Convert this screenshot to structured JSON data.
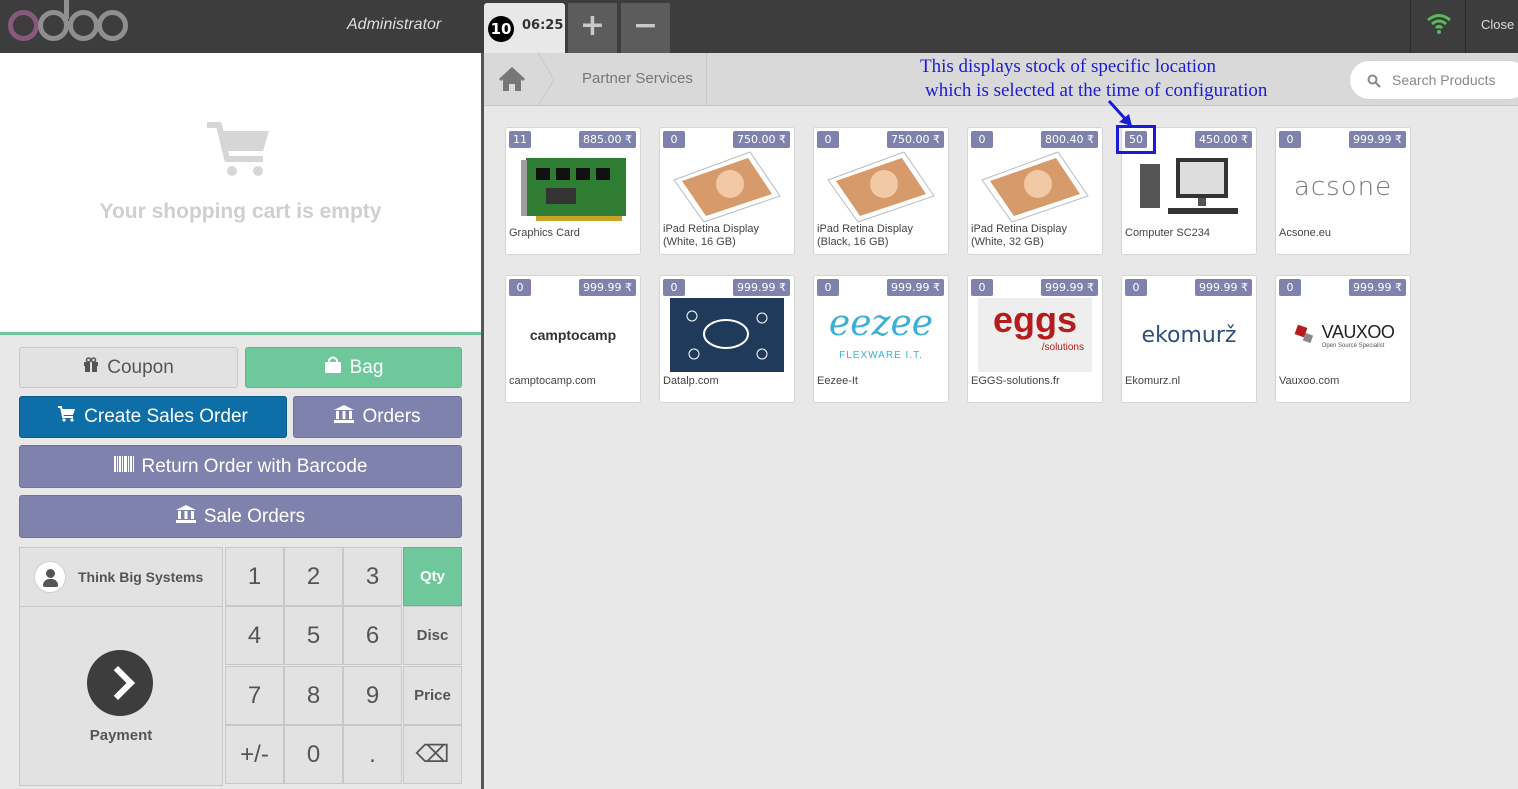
{
  "header": {
    "user": "Administrator",
    "order_number": "10",
    "order_time": "06:25",
    "add_label": "+",
    "remove_label": "−",
    "close_label": "Close"
  },
  "cart": {
    "empty_text": "Your shopping cart is empty"
  },
  "actions": {
    "coupon": "Coupon",
    "bag": "Bag",
    "create_sales_order": "Create Sales Order",
    "orders": "Orders",
    "return_order": "Return Order with Barcode",
    "sale_orders": "Sale Orders"
  },
  "customer": {
    "name": "Think Big Systems"
  },
  "payment_label": "Payment",
  "numpad": {
    "keys": [
      "1",
      "2",
      "3",
      "Qty",
      "4",
      "5",
      "6",
      "Disc",
      "7",
      "8",
      "9",
      "Price",
      "+/-",
      "0",
      ".",
      "⌫"
    ],
    "active_mode": "Qty"
  },
  "breadcrumb": {
    "category": "Partner Services"
  },
  "search": {
    "placeholder": "Search Products"
  },
  "annotation": {
    "line1": "This displays stock of specific location",
    "line2": "which is selected at the time of configuration"
  },
  "products": [
    {
      "name": "Graphics Card",
      "qty": "11",
      "price": "885.00 ₹"
    },
    {
      "name": "iPad Retina Display (White, 16 GB)",
      "qty": "0",
      "price": "750.00 ₹"
    },
    {
      "name": "iPad Retina Display (Black, 16 GB)",
      "qty": "0",
      "price": "750.00 ₹"
    },
    {
      "name": "iPad Retina Display (White, 32 GB)",
      "qty": "0",
      "price": "800.40 ₹"
    },
    {
      "name": "Computer SC234",
      "qty": "50",
      "price": "450.00 ₹"
    },
    {
      "name": "Acsone.eu",
      "qty": "0",
      "price": "999.99 ₹",
      "logo_text": "acsone"
    },
    {
      "name": "camptocamp.com",
      "qty": "0",
      "price": "999.99 ₹",
      "logo_text": "camptocamp"
    },
    {
      "name": "Datalp.com",
      "qty": "0",
      "price": "999.99 ₹"
    },
    {
      "name": "Eezee-It",
      "qty": "0",
      "price": "999.99 ₹",
      "logo_text": "eezee",
      "logo_sub": "FLEXWARE I.T."
    },
    {
      "name": "EGGS-solutions.fr",
      "qty": "0",
      "price": "999.99 ₹",
      "logo_text": "eggs",
      "logo_sub": "/solutions"
    },
    {
      "name": "Ekomurz.nl",
      "qty": "0",
      "price": "999.99 ₹",
      "logo_text": "ekomurž"
    },
    {
      "name": "Vauxoo.com",
      "qty": "0",
      "price": "999.99 ₹",
      "logo_text": "VAUXOO",
      "logo_sub": "Open Source Specialist"
    }
  ],
  "colors": {
    "accent_green": "#6ec89b",
    "primary_blue": "#0e6ea8",
    "lavender": "#7f82ac",
    "annotation_blue": "#1b1bd6",
    "header_dark": "#3d3d3d"
  }
}
